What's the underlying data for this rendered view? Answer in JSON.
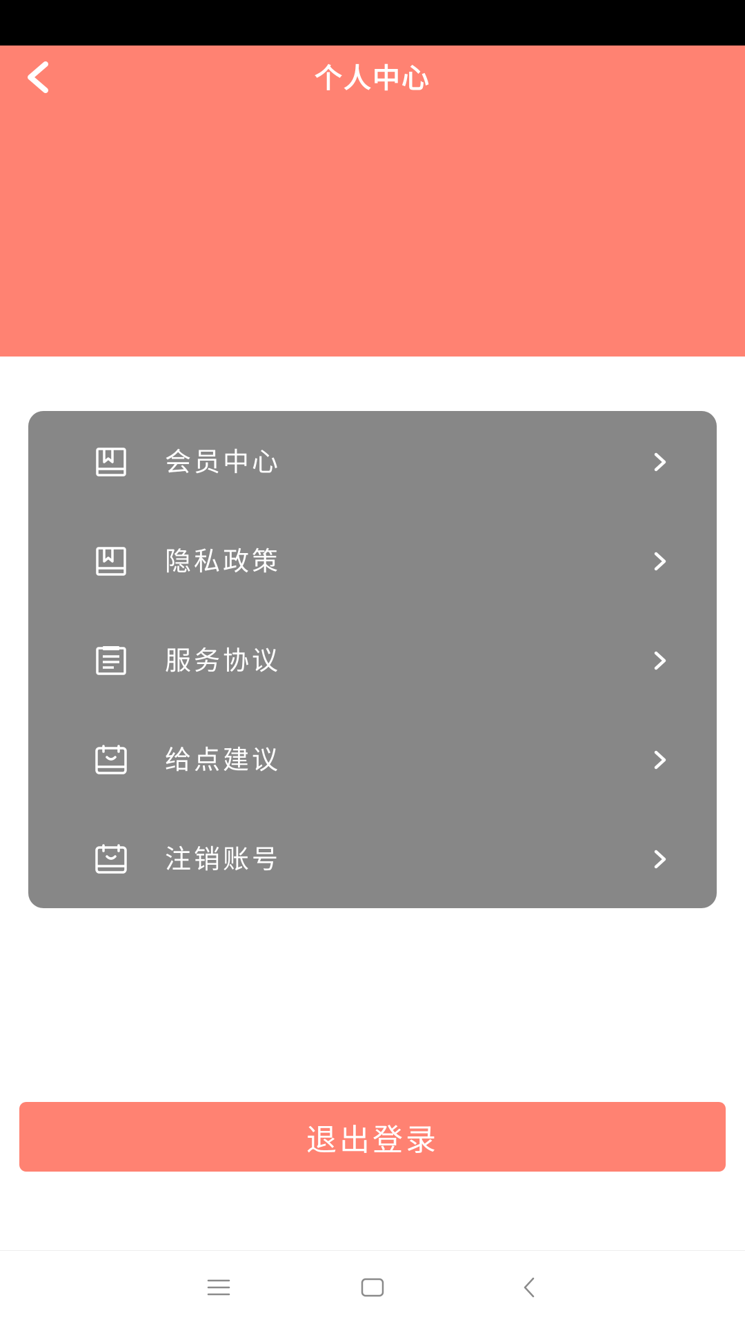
{
  "header": {
    "title": "个人中心",
    "back_icon": "chevron-left-icon",
    "background_color": "#FF8272"
  },
  "menu": {
    "background_color": "#878787",
    "items": [
      {
        "label": "会员中心",
        "icon": "book-icon"
      },
      {
        "label": "隐私政策",
        "icon": "book-icon"
      },
      {
        "label": "服务协议",
        "icon": "document-icon"
      },
      {
        "label": "给点建议",
        "icon": "feedback-icon"
      },
      {
        "label": "注销账号",
        "icon": "feedback-icon"
      }
    ]
  },
  "logout": {
    "label": "退出登录",
    "color": "#FF8272"
  },
  "nav_bar": {
    "buttons": [
      "menu-icon",
      "home-icon",
      "back-icon"
    ]
  }
}
